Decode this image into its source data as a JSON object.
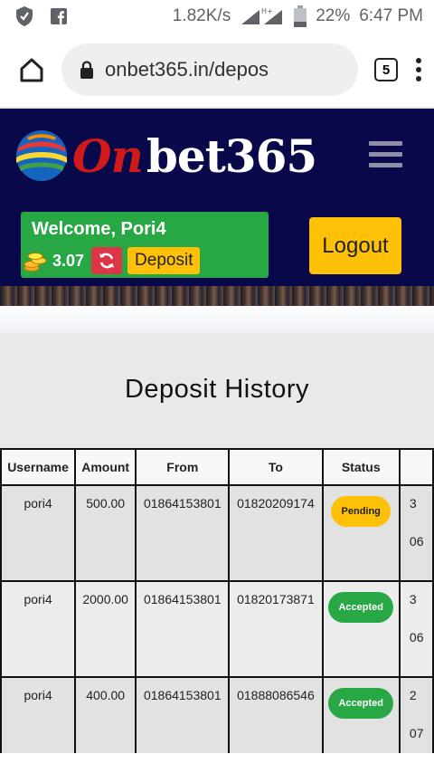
{
  "status_bar": {
    "speed": "1.82K/s",
    "battery": "22%",
    "time": "6:47 PM"
  },
  "browser": {
    "url": "onbet365.in/depos",
    "tab_count": "5"
  },
  "site": {
    "logo_on": "On",
    "logo_rest": "bet365",
    "welcome": "Welcome, Pori4",
    "balance": "3.07",
    "deposit_label": "Deposit",
    "logout_label": "Logout"
  },
  "page": {
    "title": "Deposit History"
  },
  "table": {
    "headers": [
      "Username",
      "Amount",
      "From",
      "To",
      "Status"
    ],
    "rows": [
      {
        "username": "pori4",
        "amount": "500.00",
        "from": "01864153801",
        "to": "01820209174",
        "status": "Pending",
        "extra1": "3",
        "extra2": "06"
      },
      {
        "username": "pori4",
        "amount": "2000.00",
        "from": "01864153801",
        "to": "01820173871",
        "status": "Accepted",
        "extra1": "3",
        "extra2": "06"
      },
      {
        "username": "pori4",
        "amount": "400.00",
        "from": "01864153801",
        "to": "01888086546",
        "status": "Accepted",
        "extra1": "2",
        "extra2": "07"
      }
    ]
  },
  "colors": {
    "header_bg": "#08084a",
    "success": "#28a745",
    "warning": "#ffc107",
    "danger": "#dc3545"
  }
}
